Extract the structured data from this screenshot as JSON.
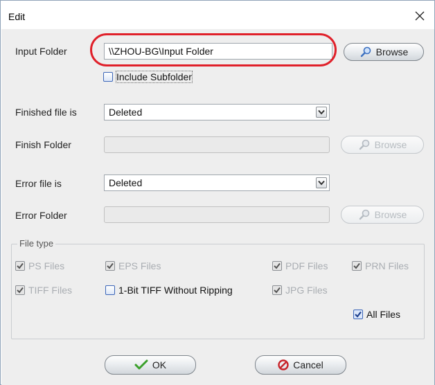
{
  "window": {
    "title": "Edit"
  },
  "input_folder": {
    "label": "Input Folder",
    "value": "\\\\ZHOU-BG\\Input Folder",
    "browse_label": "Browse",
    "include_subfolder_label": "Include Subfolder",
    "include_subfolder_checked": false
  },
  "finished": {
    "label": "Finished file is",
    "value": "Deleted",
    "folder_label": "Finish Folder",
    "folder_value": "",
    "browse_label": "Browse"
  },
  "error": {
    "label": "Error file is",
    "value": "Deleted",
    "folder_label": "Error Folder",
    "folder_value": "",
    "browse_label": "Browse"
  },
  "file_type": {
    "title": "File type",
    "ps": "PS Files",
    "eps": "EPS Files",
    "pdf": "PDF Files",
    "prn": "PRN Files",
    "tiff": "TIFF Files",
    "onebit": "1-Bit TIFF Without Ripping",
    "jpg": "JPG Files",
    "all": "All Files"
  },
  "buttons": {
    "ok": "OK",
    "cancel": "Cancel"
  },
  "colors": {
    "accent_blue": "#2f63c4",
    "highlight_red": "#e0202a",
    "ok_green": "#3aa02a",
    "cancel_red": "#c8242a"
  },
  "icons": {
    "close": "close-icon",
    "browse": "magnifier-icon",
    "dropdown": "chevron-down-icon",
    "ok": "checkmark-icon",
    "cancel": "prohibited-icon"
  }
}
